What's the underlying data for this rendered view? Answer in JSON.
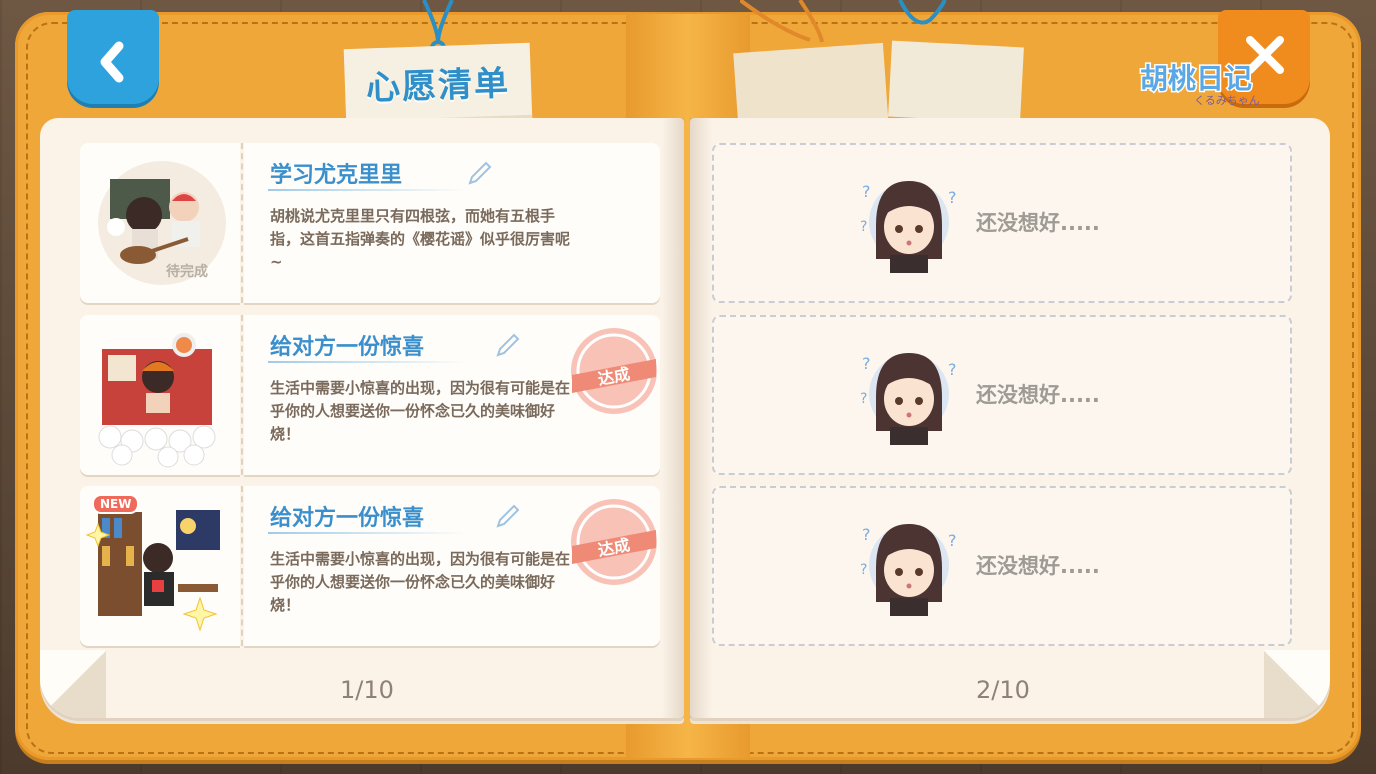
{
  "header": {
    "title": "心愿清单",
    "logo_text": "胡桃日记",
    "logo_subtext": "くるみちゃん"
  },
  "buttons": {
    "back_icon": "chevron-left-icon",
    "close_icon": "close-icon"
  },
  "left_page": {
    "page_number": "1/10",
    "wishes": [
      {
        "title": "学习尤克里里",
        "description": "胡桃说尤克里里只有四根弦，而她有五根手指，这首五指弹奏的《樱花谣》似乎很厉害呢~",
        "status_label": "待完成",
        "completed": false,
        "is_new": false
      },
      {
        "title": "给对方一份惊喜",
        "description": "生活中需要小惊喜的出现，因为很有可能是在乎你的人想要送你一份怀念已久的美味御好烧！",
        "stamp_label": "达成",
        "completed": true,
        "is_new": false
      },
      {
        "title": "给对方一份惊喜",
        "description": "生活中需要小惊喜的出现，因为很有可能是在乎你的人想要送你一份怀念已久的美味御好烧！",
        "stamp_label": "达成",
        "new_label": "NEW",
        "completed": true,
        "is_new": true
      }
    ]
  },
  "right_page": {
    "page_number": "2/10",
    "empty_slots": [
      {
        "text": "还没想好....."
      },
      {
        "text": "还没想好....."
      },
      {
        "text": "还没想好....."
      }
    ]
  },
  "colors": {
    "cover": "#f0a73a",
    "back_button": "#2ea2dc",
    "close_button": "#f08b1d",
    "title_blue": "#3a8fcc",
    "stamp_red": "#ef8a77",
    "paper": "#fbf3e8"
  }
}
